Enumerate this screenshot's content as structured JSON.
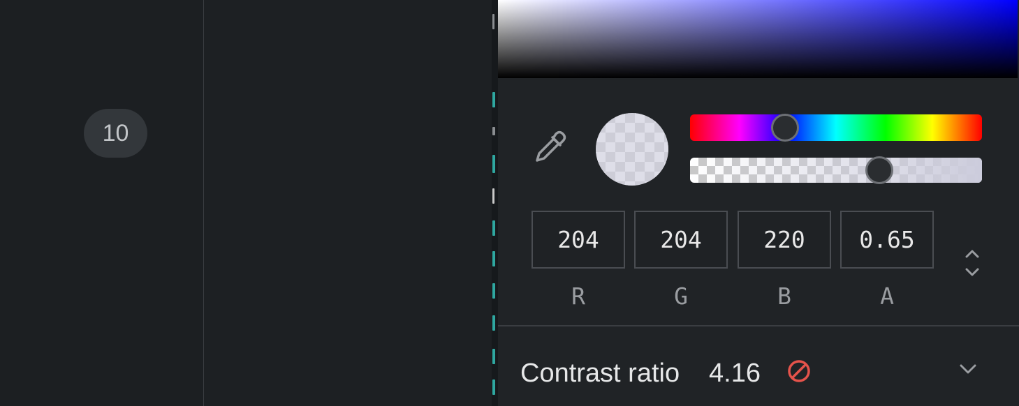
{
  "gutter": {
    "line_number": "10"
  },
  "color_picker": {
    "current_color": {
      "r": "204",
      "g": "204",
      "b": "220",
      "a": "0.65"
    },
    "channel_labels": {
      "r": "R",
      "g": "G",
      "b": "B",
      "a": "A"
    },
    "hue_level": 0.33,
    "alpha_level": 0.65
  },
  "contrast": {
    "label": "Contrast ratio",
    "value": "4.16",
    "status_color": "#e5534b"
  },
  "colors": {
    "accent_fail": "#e5534b",
    "code_accent": "#2fa7a0"
  }
}
